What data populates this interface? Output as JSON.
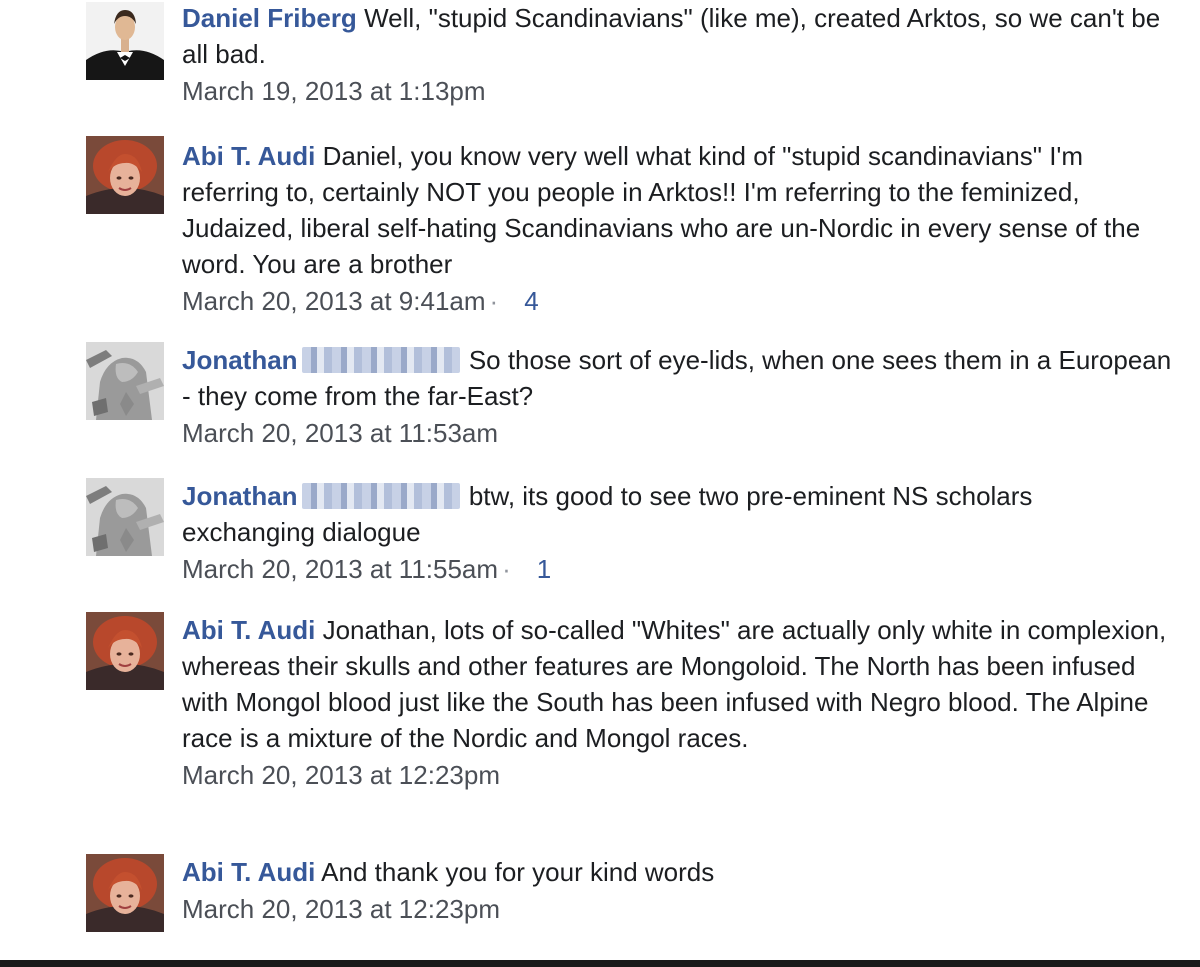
{
  "comments": [
    {
      "author": "Daniel Friberg",
      "text": "Well, \"stupid Scandinavians\" (like me), created Arktos, so we can't be all bad.",
      "timestamp": "March 19, 2013 at 1:13pm",
      "likes": ""
    },
    {
      "author": "Abi T. Audi",
      "text": "Daniel, you know very well what kind of \"stupid scandinavians\" I'm referring to, certainly NOT you people in Arktos!! I'm referring to the feminized, Judaized, liberal self-hating Scandinavians who are un-Nordic in every sense of the word. You are a brother",
      "timestamp": "March 20, 2013 at 9:41am",
      "likes": "4"
    },
    {
      "author": "Jonathan",
      "text": "So those sort of eye-lids, when one sees them in a European - they come from the far-East?",
      "timestamp": "March 20, 2013 at 11:53am",
      "likes": ""
    },
    {
      "author": "Jonathan",
      "text": "btw, its good to see two pre-eminent NS scholars exchanging dialogue",
      "timestamp": "March 20, 2013 at 11:55am",
      "likes": "1"
    },
    {
      "author": "Abi T. Audi",
      "text": "Jonathan, lots of so-called \"Whites\" are actually only white in complexion, whereas their skulls and other features are Mongoloid. The North has been infused with Mongol blood just like the South has been infused with Negro blood. The Alpine race is a mixture of the Nordic and Mongol races.",
      "timestamp": "March 20, 2013 at 12:23pm",
      "likes": ""
    },
    {
      "author": "Abi T. Audi",
      "text": "And thank you for your kind words",
      "timestamp": "March 20, 2013 at 12:23pm",
      "likes": ""
    }
  ],
  "separator": "·",
  "colors": {
    "author_link": "#365899",
    "text": "#1c1e21",
    "meta": "#4b4f56"
  }
}
